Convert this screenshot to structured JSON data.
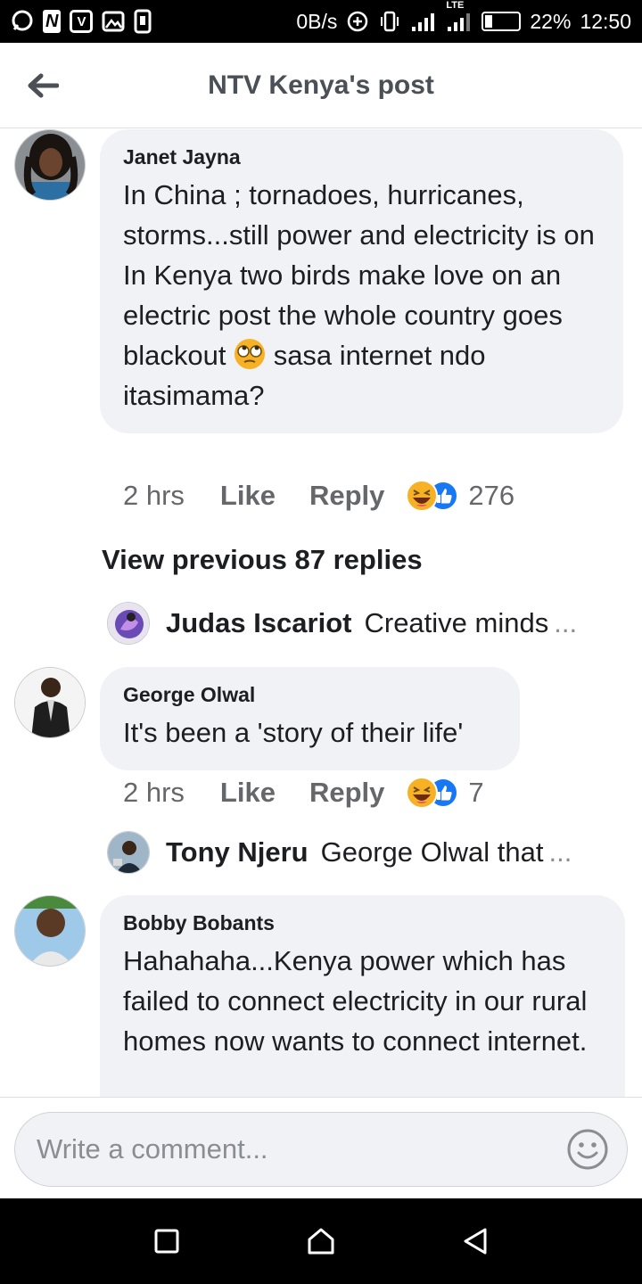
{
  "status_bar": {
    "net_speed": "0B/s",
    "network_type": "LTE",
    "battery": "22%",
    "time": "12:50"
  },
  "header": {
    "title": "NTV Kenya's post"
  },
  "comments": [
    {
      "author": "Janet Jayna",
      "text_before_emoji": "In China ; tornadoes, hurricanes, storms...still power and electricity is on\nIn Kenya two birds make love on an electric post the whole country goes blackout ",
      "text_after_emoji": " sasa internet ndo itasimama?",
      "inline_emoji": "eye-roll-emoji",
      "time": "2 hrs",
      "like_label": "Like",
      "reply_label": "Reply",
      "reaction_count": "276"
    },
    {
      "author": "George Olwal",
      "text": "It's been a 'story of their life'",
      "time": "2 hrs",
      "like_label": "Like",
      "reply_label": "Reply",
      "reaction_count": "7"
    },
    {
      "author": "Bobby Bobants",
      "text": "Hahahaha...Kenya power which has failed to connect electricity in our rural homes now wants to connect internet."
    }
  ],
  "view_previous": "View previous 87 replies",
  "replies": [
    {
      "author": "Judas Iscariot",
      "snippet": "Creative minds ",
      "ellipsis": "..."
    },
    {
      "author": "Tony Njeru",
      "snippet": "George Olwal that",
      "ellipsis": "..."
    }
  ],
  "composer": {
    "placeholder": "Write a comment..."
  },
  "colors": {
    "bubble": "#f0f2f5",
    "secondary_text": "#65676b",
    "like_blue": "#1877f2",
    "haha_yellow": "#f7b125"
  }
}
